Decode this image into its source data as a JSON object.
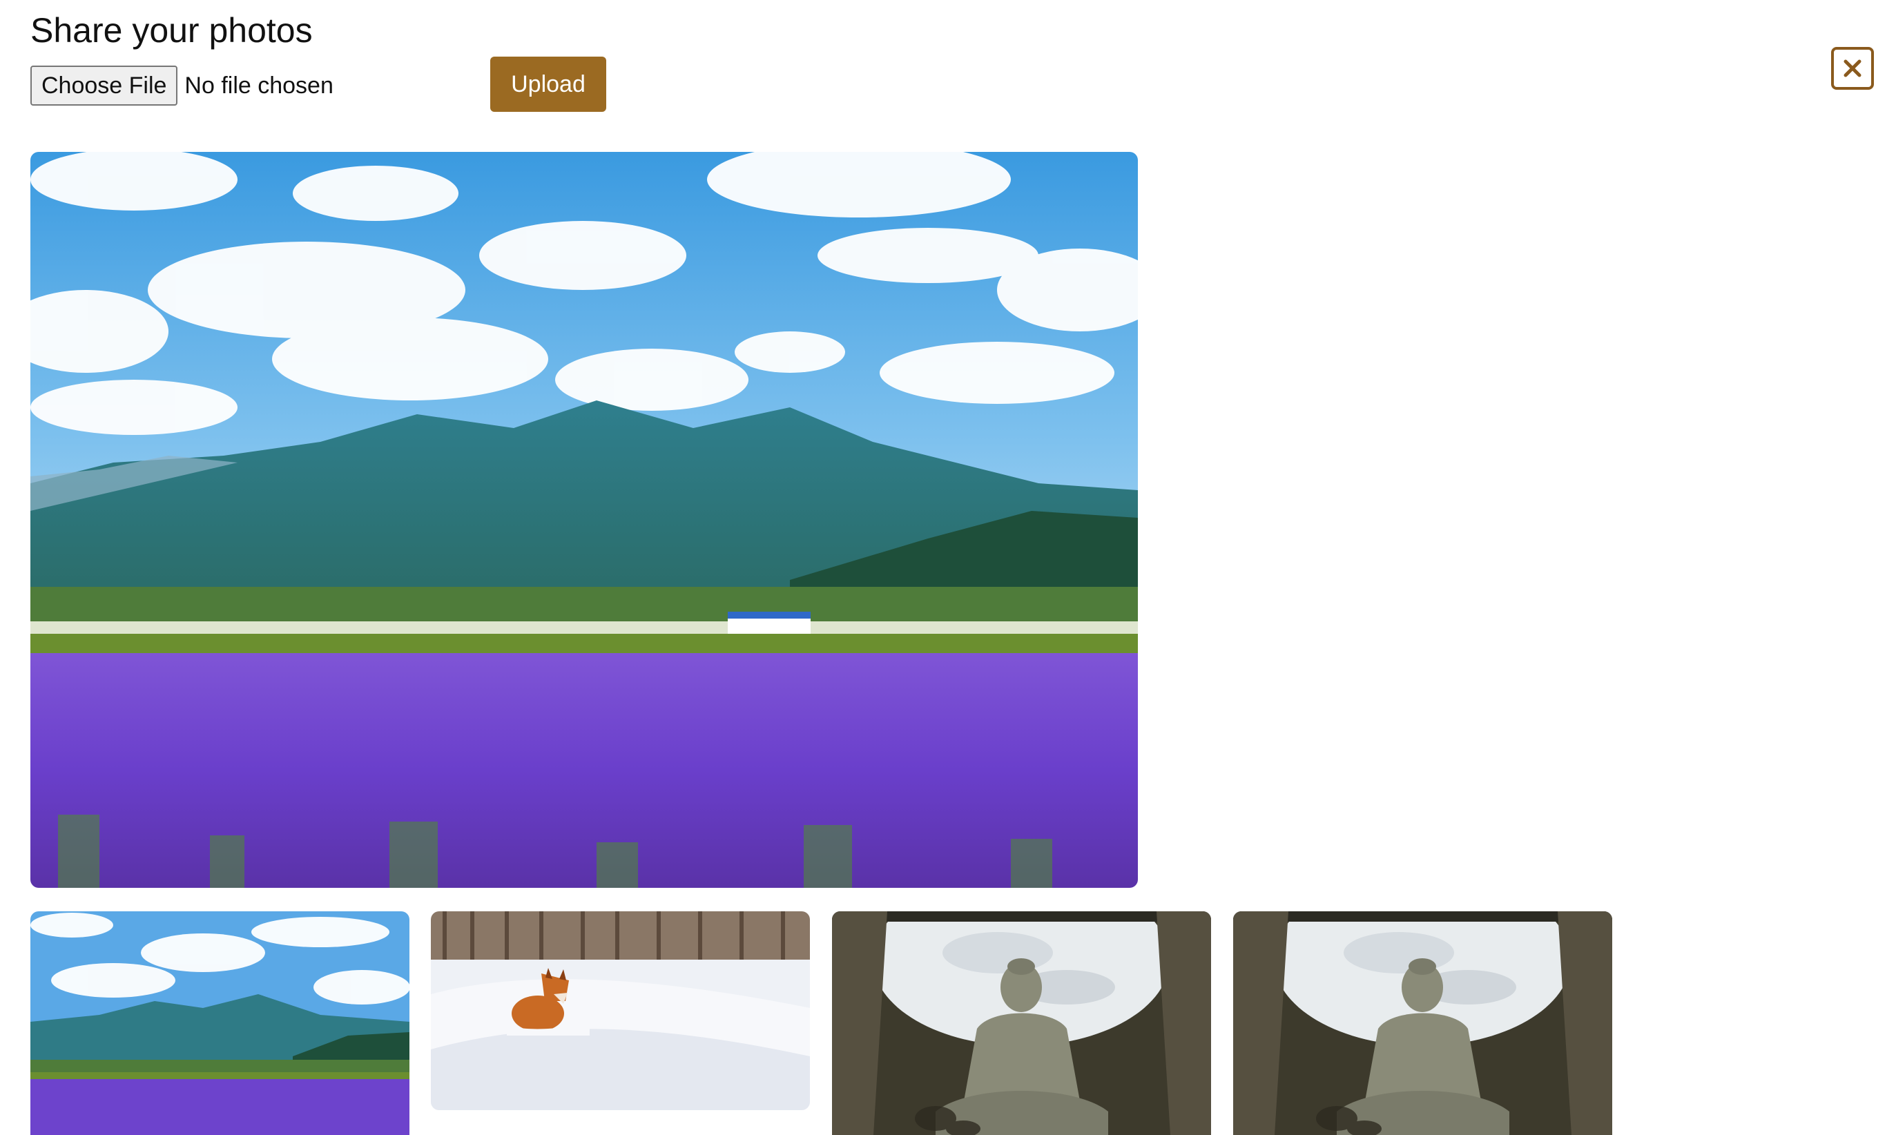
{
  "header": {
    "title": "Share your photos"
  },
  "uploader": {
    "choose_file_label": "Choose File",
    "file_status": "No file chosen",
    "upload_label": "Upload"
  },
  "colors": {
    "accent": "#9b6a22",
    "close_border": "#8a5a1d"
  },
  "icons": {
    "close": "close-icon"
  },
  "gallery": {
    "main_photo": "lavender-field-mountains",
    "thumbnails": [
      "lavender-field-mountains",
      "fox-in-snow",
      "buddha-statue-dome",
      "buddha-statue-dome"
    ]
  }
}
